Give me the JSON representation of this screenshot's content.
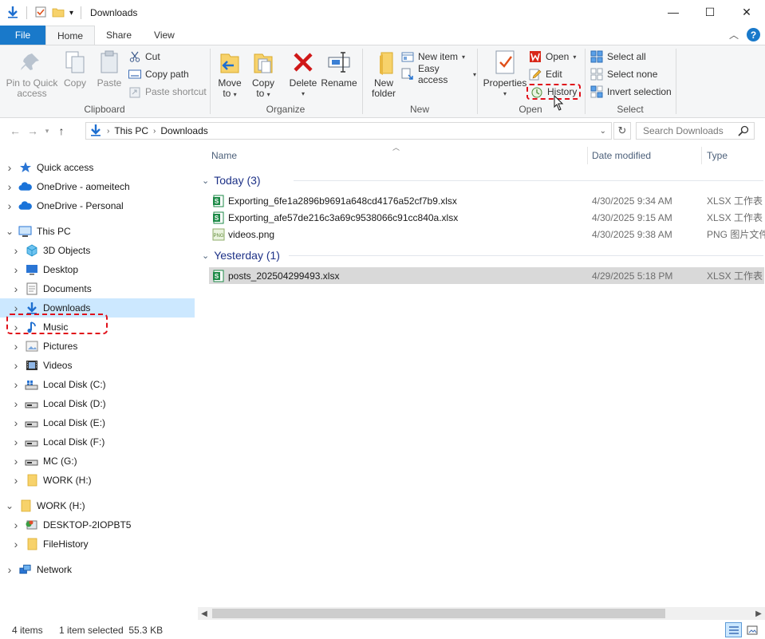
{
  "window": {
    "title": "Downloads",
    "controls": {
      "minimize": "—",
      "maximize": "☐",
      "close": "✕"
    }
  },
  "ribbon_tabs": {
    "file": "File",
    "home": "Home",
    "share": "Share",
    "view": "View"
  },
  "ribbon": {
    "clipboard": {
      "label": "Clipboard",
      "pin_line1": "Pin to Quick",
      "pin_line2": "access",
      "copy": "Copy",
      "paste": "Paste",
      "cut": "Cut",
      "copy_path": "Copy path",
      "paste_shortcut": "Paste shortcut"
    },
    "organize": {
      "label": "Organize",
      "move_to_line1": "Move",
      "move_to_line2": "to",
      "copy_to_line1": "Copy",
      "copy_to_line2": "to",
      "delete": "Delete",
      "rename": "Rename"
    },
    "new": {
      "label": "New",
      "new_folder_line1": "New",
      "new_folder_line2": "folder",
      "new_item": "New item",
      "easy_access": "Easy access"
    },
    "open": {
      "label": "Open",
      "properties": "Properties",
      "open": "Open",
      "edit": "Edit",
      "history": "History"
    },
    "select": {
      "label": "Select",
      "select_all": "Select all",
      "select_none": "Select none",
      "invert_selection": "Invert selection"
    }
  },
  "address": {
    "path": [
      "This PC",
      "Downloads"
    ],
    "search_placeholder": "Search Downloads"
  },
  "nav": [
    {
      "label": "Quick access",
      "icon": "star-icon",
      "level": 0,
      "expanded": false
    },
    {
      "label": "OneDrive - aomeitech",
      "icon": "cloud-icon",
      "level": 0,
      "expanded": false
    },
    {
      "label": "OneDrive - Personal",
      "icon": "cloud-icon",
      "level": 0,
      "expanded": false
    },
    {
      "label": "This PC",
      "icon": "pc-icon",
      "level": 0,
      "expanded": true
    },
    {
      "label": "3D Objects",
      "icon": "cube-icon",
      "level": 1,
      "expanded": false
    },
    {
      "label": "Desktop",
      "icon": "desktop-icon",
      "level": 1,
      "expanded": false
    },
    {
      "label": "Documents",
      "icon": "documents-icon",
      "level": 1,
      "expanded": false
    },
    {
      "label": "Downloads",
      "icon": "download-icon",
      "level": 1,
      "expanded": false,
      "selected": true
    },
    {
      "label": "Music",
      "icon": "music-icon",
      "level": 1,
      "expanded": false
    },
    {
      "label": "Pictures",
      "icon": "pictures-icon",
      "level": 1,
      "expanded": false
    },
    {
      "label": "Videos",
      "icon": "videos-icon",
      "level": 1,
      "expanded": false
    },
    {
      "label": "Local Disk (C:)",
      "icon": "system-drive-icon",
      "level": 1,
      "expanded": false
    },
    {
      "label": "Local Disk (D:)",
      "icon": "drive-icon",
      "level": 1,
      "expanded": false
    },
    {
      "label": "Local Disk (E:)",
      "icon": "drive-icon",
      "level": 1,
      "expanded": false
    },
    {
      "label": "Local Disk (F:)",
      "icon": "drive-icon",
      "level": 1,
      "expanded": false
    },
    {
      "label": "MC (G:)",
      "icon": "drive-icon",
      "level": 1,
      "expanded": false
    },
    {
      "label": "WORK (H:)",
      "icon": "folder-icon",
      "level": 1,
      "expanded": false
    },
    {
      "label": "WORK (H:)",
      "icon": "folder-icon",
      "level": 0,
      "expanded": true
    },
    {
      "label": "DESKTOP-2IOPBT5",
      "icon": "network-computer-icon",
      "level": 1,
      "expanded": false
    },
    {
      "label": "FileHistory",
      "icon": "folder-icon",
      "level": 1,
      "expanded": false
    },
    {
      "label": "Network",
      "icon": "network-icon",
      "level": 0,
      "expanded": false
    }
  ],
  "columns": {
    "name": "Name",
    "date": "Date modified",
    "type": "Type"
  },
  "groups": [
    {
      "title": "Today (3)",
      "files": [
        {
          "name": "Exporting_6fe1a2896b9691a648cd4176a52cf7b9.xlsx",
          "date": "4/30/2025 9:34 AM",
          "type": "XLSX 工作表",
          "icon": "xlsx-icon"
        },
        {
          "name": "Exporting_afe57de216c3a69c9538066c91cc840a.xlsx",
          "date": "4/30/2025 9:15 AM",
          "type": "XLSX 工作表",
          "icon": "xlsx-icon"
        },
        {
          "name": "videos.png",
          "date": "4/30/2025 9:38 AM",
          "type": "PNG 图片文件",
          "icon": "png-icon"
        }
      ]
    },
    {
      "title": "Yesterday (1)",
      "files": [
        {
          "name": "posts_202504299493.xlsx",
          "date": "4/29/2025 5:18 PM",
          "type": "XLSX 工作表",
          "icon": "xlsx-icon",
          "selected": true
        }
      ]
    }
  ],
  "status": {
    "items": "4 items",
    "selection": "1 item selected  55.3 KB"
  },
  "colors": {
    "accent": "#1979ca",
    "selected_nav": "#cce8ff",
    "highlight_red": "#e0101a",
    "group_title": "#1e3287"
  }
}
